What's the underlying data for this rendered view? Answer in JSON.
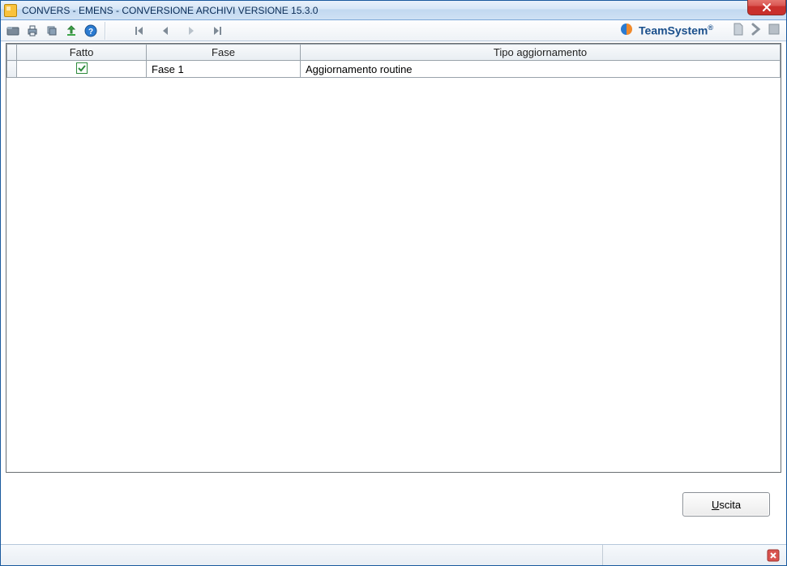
{
  "window": {
    "title": "CONVERS  - EMENS -   CONVERSIONE ARCHIVI VERSIONE 15.3.0"
  },
  "brand": {
    "name": "TeamSystem",
    "reg": "®"
  },
  "grid": {
    "headers": {
      "fatto": "Fatto",
      "fase": "Fase",
      "tipo": "Tipo aggiornamento"
    },
    "rows": [
      {
        "fatto": true,
        "fase": "Fase 1",
        "tipo": "Aggiornamento routine"
      }
    ]
  },
  "buttons": {
    "uscita_prefix": "U",
    "uscita_rest": "scita"
  }
}
